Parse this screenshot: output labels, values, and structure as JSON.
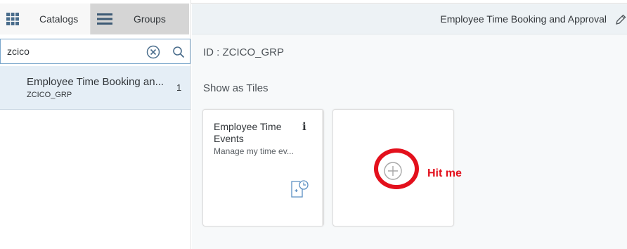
{
  "tabs": {
    "catalogs_label": "Catalogs",
    "groups_label": "Groups",
    "catalogs_icon": "grid-icon",
    "groups_icon": "hamburger-menu-icon"
  },
  "search": {
    "value": "zcico",
    "clear_icon": "clear-circle-icon",
    "search_icon": "search-icon"
  },
  "list": {
    "items": [
      {
        "title": "Employee Time Booking an...",
        "subtitle": "ZCICO_GRP",
        "count": "1"
      }
    ]
  },
  "header": {
    "title": "Employee Time Booking and Approval",
    "edit_icon": "pencil-icon"
  },
  "group": {
    "id_label": "ID : ZCICO_GRP",
    "section_label": "Show as Tiles"
  },
  "tiles": [
    {
      "title": "Employee Time Events",
      "subtitle": "Manage my time ev...",
      "info_glyph": "i",
      "icon": "time-entry-icon"
    }
  ],
  "add_tile": {
    "icon": "add-circle-icon"
  },
  "annotation": {
    "label": "Hit me",
    "color": "#e3101c"
  },
  "colors": {
    "accent": "#7aa6cc",
    "selection": "#e5eef6",
    "header_bg": "#edf2f5"
  }
}
